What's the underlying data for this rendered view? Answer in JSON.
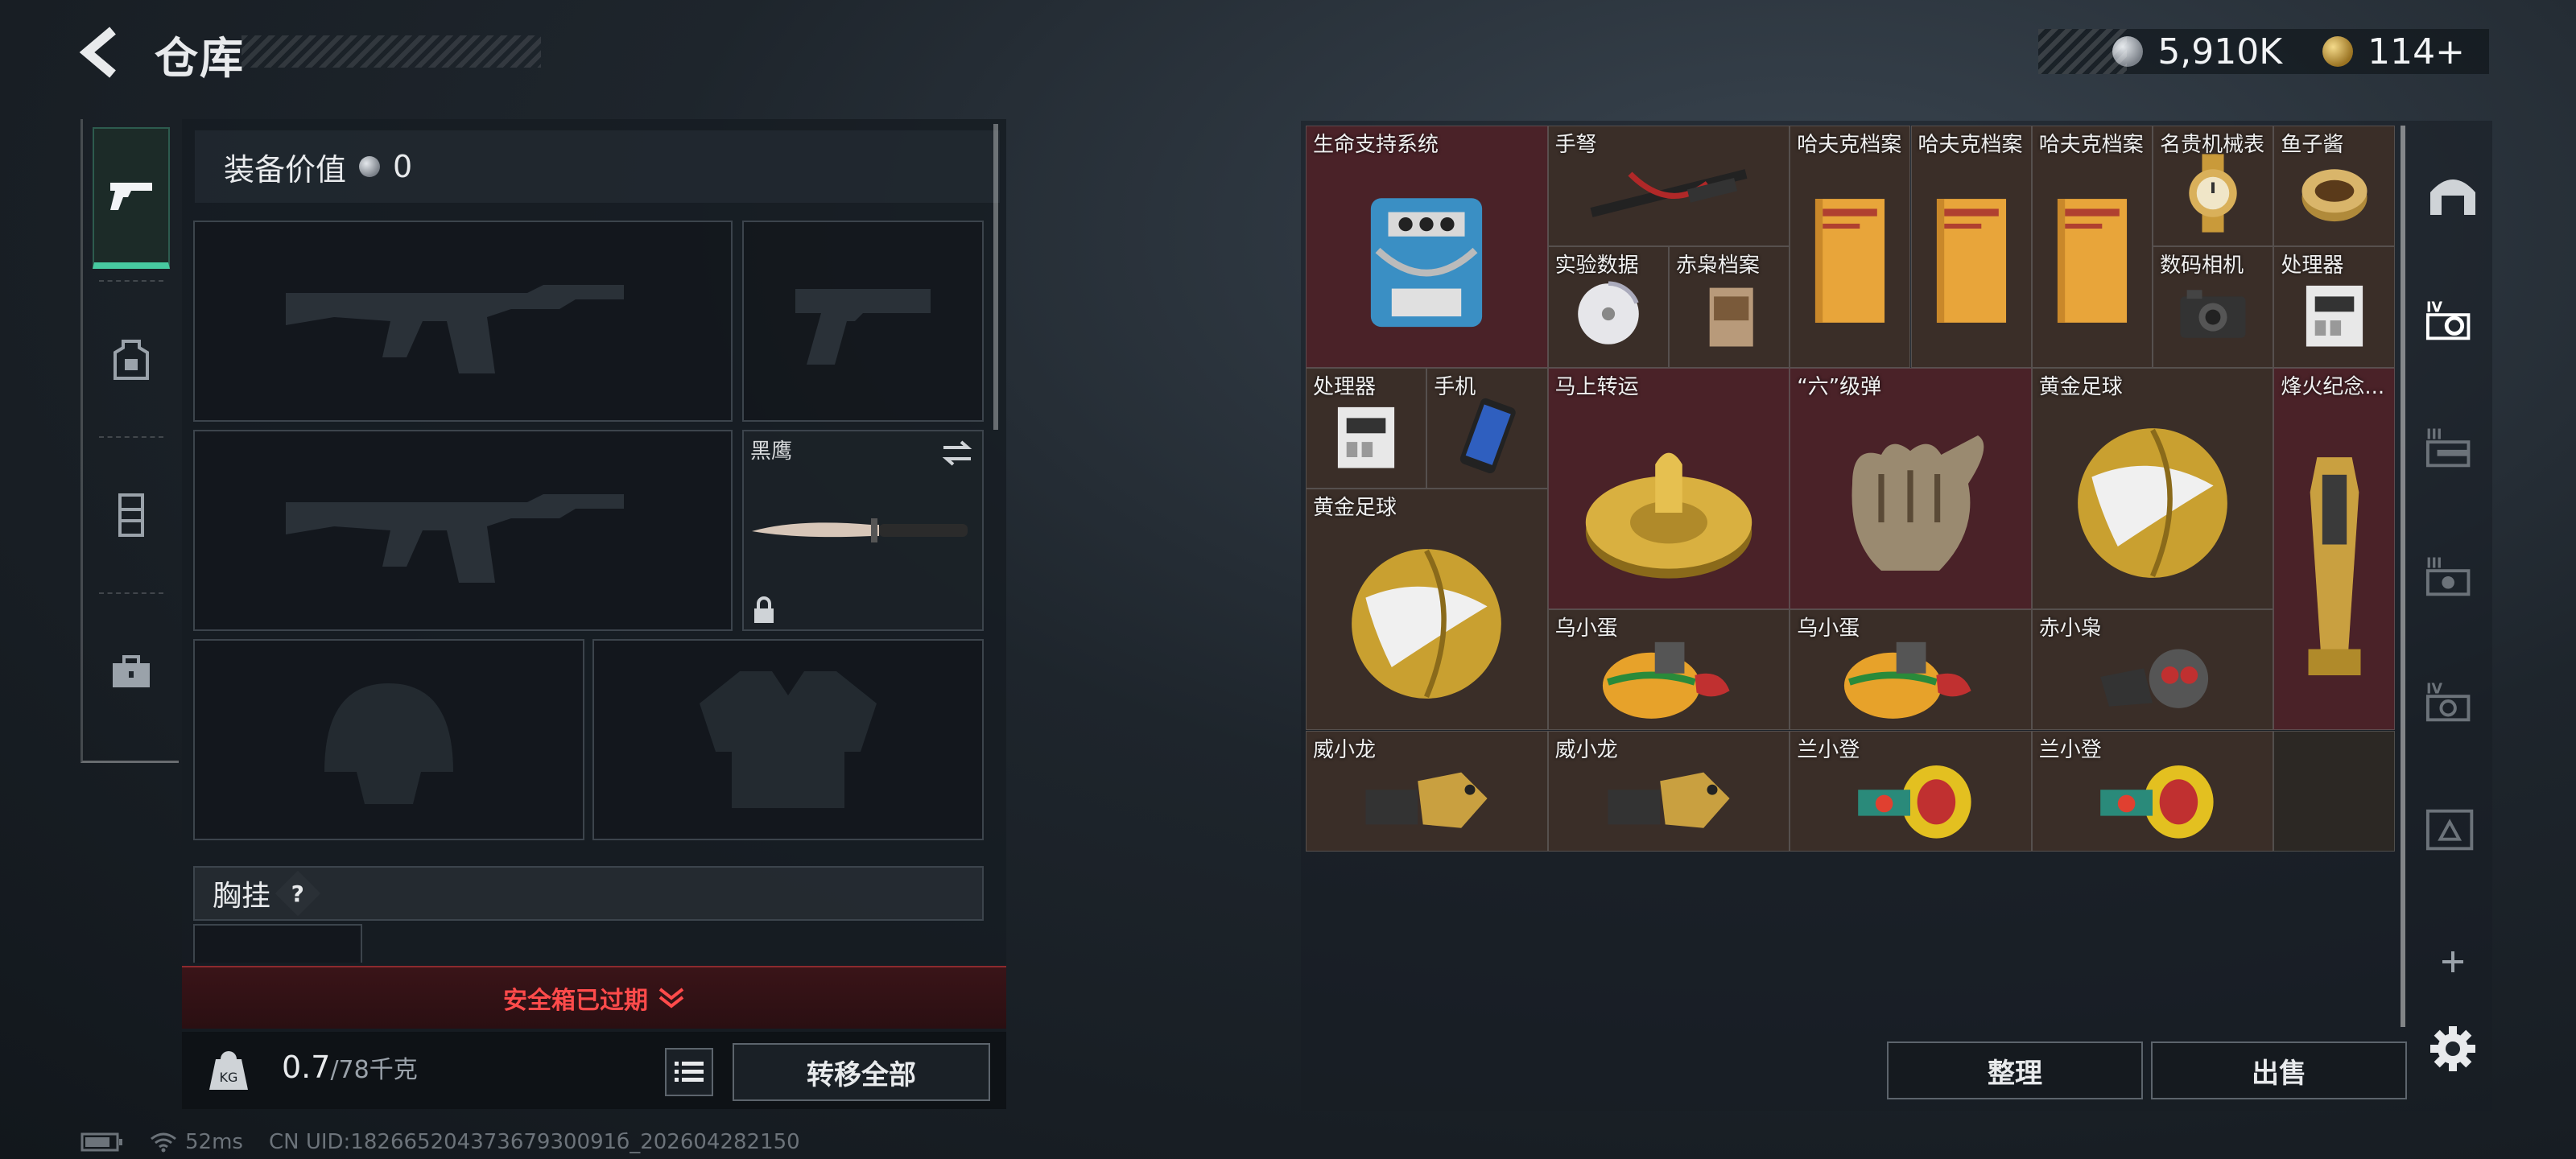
{
  "header": {
    "title": "仓库",
    "silver_amount": "5,910K",
    "gold_amount": "114+"
  },
  "equipment": {
    "value_label": "装备价值",
    "value": "0",
    "melee_name": "黑鹰",
    "chest_rig_label": "胸挂",
    "chest_rig_help": "?",
    "safe_box_status": "安全箱已过期",
    "weight_current": "0.7",
    "weight_capacity": "/78千克",
    "transfer_all": "转移全部"
  },
  "status_bar": {
    "ping": "52ms",
    "uid": "CN UID:18266520437367930091б_202604282150"
  },
  "warehouse": {
    "items": [
      {
        "label": "生命支持系统",
        "icon": "life-support-system-icon"
      },
      {
        "label": "手弩",
        "icon": "crossbow-icon"
      },
      {
        "label": "哈夫克档案",
        "icon": "document-folder-icon"
      },
      {
        "label": "哈夫克档案",
        "icon": "document-folder-icon"
      },
      {
        "label": "哈夫克档案",
        "icon": "document-folder-icon"
      },
      {
        "label": "名贵机械表",
        "icon": "luxury-watch-icon"
      },
      {
        "label": "鱼子酱",
        "icon": "caviar-tin-icon"
      },
      {
        "label": "实验数据",
        "icon": "data-disc-icon"
      },
      {
        "label": "赤枭档案",
        "icon": "archive-box-icon"
      },
      {
        "label": "数码相机",
        "icon": "camera-icon"
      },
      {
        "label": "处理器",
        "icon": "processor-icon"
      },
      {
        "label": "处理器",
        "icon": "processor-icon"
      },
      {
        "label": "手机",
        "icon": "phone-icon"
      },
      {
        "label": "马上转运",
        "icon": "golden-horse-dial-icon"
      },
      {
        "label": "“六”级弹",
        "icon": "fist-sculpture-icon"
      },
      {
        "label": "黄金足球",
        "icon": "golden-football-icon"
      },
      {
        "label": "烽火纪念...",
        "icon": "trophy-icon"
      },
      {
        "label": "黄金足球",
        "icon": "golden-football-icon"
      },
      {
        "label": "乌小蛋",
        "icon": "egg-figure-icon"
      },
      {
        "label": "乌小蛋",
        "icon": "egg-figure-icon"
      },
      {
        "label": "赤小枭",
        "icon": "owl-figure-icon"
      },
      {
        "label": "威小龙",
        "icon": "dragon-figure-icon"
      },
      {
        "label": "威小龙",
        "icon": "dragon-figure-icon"
      },
      {
        "label": "兰小登",
        "icon": "sombrero-figure-icon"
      },
      {
        "label": "兰小登",
        "icon": "sombrero-figure-icon"
      }
    ],
    "sort_button": "整理",
    "sell_button": "出售"
  },
  "colors": {
    "accent_green": "#47c9a0",
    "warning_red": "#ff4b4b",
    "rare_cell": "#4a2228",
    "common_cell": "#3a2e28"
  }
}
